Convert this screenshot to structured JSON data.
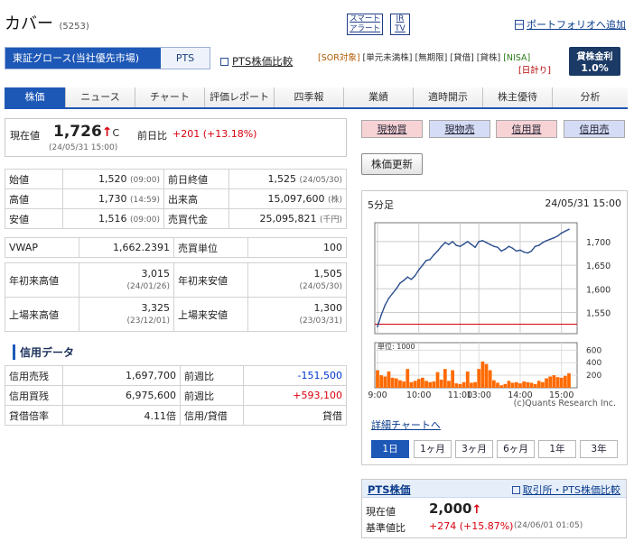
{
  "header": {
    "company": "カバー",
    "code": "(5253)",
    "smart_alert": [
      "スマート",
      "アラート"
    ],
    "ir_tv": [
      "IR",
      "TV"
    ],
    "portfolio": "ポートフォリオへ追加"
  },
  "market": {
    "selected": "東証グロース(当社優先市場)",
    "pts": "PTS",
    "pts_compare": "PTS株価比較",
    "tags_row1": [
      "[SOR対象]",
      "[単元未満株]",
      "[無期限]",
      "[貸借]",
      "[貸株]",
      "[NISA]"
    ],
    "tags_row2": [
      "[日計り]"
    ],
    "lending_label": "貸株金利",
    "lending_rate": "1.0%"
  },
  "tabs": [
    "株価",
    "ニュース",
    "チャート",
    "評価レポート",
    "四季報",
    "業績",
    "適時開示",
    "株主優待",
    "分析"
  ],
  "quote": {
    "current_label": "現在値",
    "price": "1,726",
    "arrow": "↑",
    "flag": "C",
    "change_label": "前日比",
    "change": "+201 (+13.18%)",
    "time": "(24/05/31 15:00)"
  },
  "trade_buttons": [
    "現物買",
    "現物売",
    "信用買",
    "信用売"
  ],
  "refresh_button": "株価更新",
  "stats": [
    {
      "k1": "始値",
      "v1": "1,520",
      "t1": "(09:00)",
      "k2": "前日終値",
      "v2": "1,525",
      "t2": "(24/05/30)"
    },
    {
      "k1": "高値",
      "v1": "1,730",
      "t1": "(14:59)",
      "k2": "出来高",
      "v2": "15,097,600",
      "t2": "(株)"
    },
    {
      "k1": "安値",
      "v1": "1,516",
      "t1": "(09:00)",
      "k2": "売買代金",
      "v2": "25,095,821",
      "t2": "(千円)"
    }
  ],
  "vwap": {
    "k1": "VWAP",
    "v1": "1,662.2391",
    "k2": "売買単位",
    "v2": "100"
  },
  "yearly": [
    {
      "k1": "年初来高値",
      "v1": "3,015",
      "d1": "(24/01/26)",
      "k2": "年初来安値",
      "v2": "1,505",
      "d2": "(24/05/30)"
    },
    {
      "k1": "上場来高値",
      "v1": "3,325",
      "d1": "(23/12/01)",
      "k2": "上場来安値",
      "v2": "1,300",
      "d2": "(23/03/31)"
    }
  ],
  "margin": {
    "title": "信用データ",
    "rows": [
      {
        "k1": "信用売残",
        "v1": "1,697,700",
        "k2": "前週比",
        "v2": "-151,500"
      },
      {
        "k1": "信用買残",
        "v1": "6,975,600",
        "k2": "前週比",
        "v2": "+593,100"
      },
      {
        "k1": "貸借倍率",
        "v1": "4.11倍",
        "k2": "信用/貸借",
        "v2": "貸借"
      }
    ]
  },
  "chart": {
    "interval": "5分足",
    "datetime": "24/05/31 15:00",
    "volume_unit": "単位: 1000",
    "credit": "(c)Quants Research Inc.",
    "detail_link": "詳細チャートへ",
    "periods": [
      "1日",
      "1ヶ月",
      "3ヶ月",
      "6ヶ月",
      "1年",
      "3年"
    ],
    "active_period": "1日"
  },
  "chart_data": {
    "type": "line",
    "x_ticks": [
      "9:00",
      "10:00",
      "11:00",
      "13:00",
      "14:00",
      "15:00"
    ],
    "y_ticks": [
      1700,
      1650,
      1600,
      1550
    ],
    "ylim": [
      1505,
      1740
    ],
    "prev_close": 1525,
    "values": [
      1520,
      1545,
      1565,
      1580,
      1590,
      1600,
      1612,
      1618,
      1625,
      1620,
      1628,
      1640,
      1650,
      1660,
      1662,
      1672,
      1680,
      1690,
      1698,
      1694,
      1700,
      1692,
      1690,
      1695,
      1700,
      1694,
      1688,
      1700,
      1702,
      1698,
      1694,
      1690,
      1688,
      1680,
      1684,
      1690,
      1686,
      1680,
      1682,
      1678,
      1676,
      1680,
      1690,
      1692,
      1698,
      1702,
      1705,
      1708,
      1712,
      1718,
      1722,
      1726
    ],
    "volume_ticks": [
      600,
      400,
      200
    ],
    "volume_ylim": [
      0,
      720
    ],
    "volume": [
      280,
      200,
      180,
      260,
      160,
      150,
      120,
      100,
      300,
      90,
      110,
      140,
      160,
      110,
      90,
      100,
      250,
      130,
      300,
      110,
      280,
      70,
      60,
      90,
      260,
      80,
      90,
      300,
      420,
      380,
      280,
      120,
      80,
      40,
      60,
      110,
      80,
      90,
      70,
      100,
      90,
      80,
      60,
      110,
      90,
      150,
      180,
      200,
      170,
      160,
      190,
      230
    ]
  },
  "pts_box": {
    "title": "PTS株価",
    "link": "取引所・PTS株価比較",
    "current_label": "現在値",
    "price": "2,000",
    "arrow": "↑",
    "base_label": "基準値比",
    "change": "+274 (+15.87%)",
    "time": "(24/06/01 01:05)"
  }
}
